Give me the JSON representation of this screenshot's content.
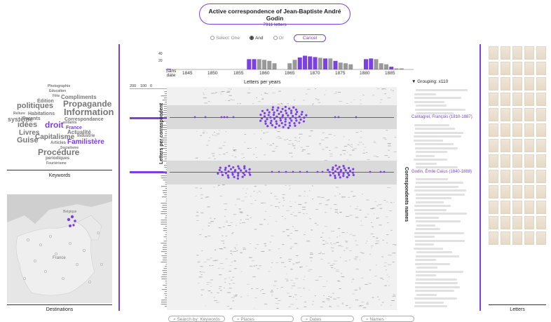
{
  "header": {
    "title": "Active correspondence of Jean-Baptiste André Godin",
    "subtitle": "7911 letters"
  },
  "select_bar": {
    "options": [
      "Select: One",
      "And",
      "Or"
    ],
    "active": "And",
    "cancel_label": "Cancel"
  },
  "keywords": {
    "label": "Keywords",
    "words": [
      {
        "text": "Photographie",
        "hl": false
      },
      {
        "text": "Education",
        "hl": false
      },
      {
        "text": "Compliments",
        "hl": false
      },
      {
        "text": "Fête",
        "hl": false
      },
      {
        "text": "Propagande",
        "hl": false
      },
      {
        "text": "Édition",
        "hl": false
      },
      {
        "text": "politiques",
        "hl": false
      },
      {
        "text": "Information",
        "hl": false
      },
      {
        "text": "Correspondance",
        "hl": false
      },
      {
        "text": "Habitations",
        "hl": false
      },
      {
        "text": "Parents",
        "hl": false
      },
      {
        "text": "Reliure",
        "hl": false
      },
      {
        "text": "système",
        "hl": false
      },
      {
        "text": "droit",
        "hl": true
      },
      {
        "text": "enfants",
        "hl": false
      },
      {
        "text": "idées",
        "hl": false
      },
      {
        "text": "France",
        "hl": true
      },
      {
        "text": "Actualité",
        "hl": false
      },
      {
        "text": "Livres",
        "hl": false
      },
      {
        "text": "Capitalisme",
        "hl": false
      },
      {
        "text": "Industrie",
        "hl": false
      },
      {
        "text": "Guise",
        "hl": false
      },
      {
        "text": "Familistère",
        "hl": true
      },
      {
        "text": "Articles",
        "hl": false
      },
      {
        "text": "Socialisme",
        "hl": false
      },
      {
        "text": "Procédure",
        "hl": false
      },
      {
        "text": "periodiques",
        "hl": false
      },
      {
        "text": "Fouriérisme",
        "hl": false
      }
    ]
  },
  "destinations": {
    "label": "Destinations",
    "map_labels": {
      "country": "France",
      "region": "Belgique"
    }
  },
  "timeline": {
    "label": "Letters per years",
    "undated_label": "Sans date",
    "years": [
      "1845",
      "1850",
      "1855",
      "1860",
      "1865",
      "1870",
      "1875",
      "1880",
      "1885"
    ],
    "y_ticks": [
      "40",
      "20"
    ],
    "x_ticks": [
      "200",
      "100",
      "0"
    ]
  },
  "chart_data": {
    "type": "bar",
    "title": "",
    "xlabel": "Letters per years",
    "ylabel": "",
    "ylim": [
      0,
      45
    ],
    "categories": [
      "Sans date",
      "1851",
      "1852",
      "1853",
      "1854",
      "1855",
      "1856",
      "1857",
      "1858",
      "1859",
      "1860",
      "1861",
      "1862",
      "1863",
      "1864",
      "1865",
      "1866",
      "1867",
      "1868",
      "1869",
      "1870",
      "1871",
      "1872",
      "1873",
      "1874",
      "1875",
      "1876",
      "1877",
      "1878",
      "1879",
      "1880",
      "1881",
      "1882"
    ],
    "series": [
      {
        "name": "",
        "values": [
          2,
          0,
          30,
          30,
          30,
          28,
          25,
          18,
          0,
          0,
          18,
          28,
          35,
          40,
          38,
          36,
          34,
          32,
          32,
          25,
          20,
          18,
          15,
          0,
          0,
          30,
          32,
          30,
          18,
          15,
          8,
          3,
          3
        ]
      }
    ],
    "highlighted": [
      true,
      false,
      true,
      true,
      false,
      false,
      false,
      false,
      false,
      false,
      false,
      false,
      true,
      true,
      true,
      true,
      false,
      true,
      false,
      true,
      false,
      false,
      false,
      false,
      false,
      true,
      true,
      false,
      false,
      false,
      true,
      false,
      false
    ]
  },
  "plot": {
    "left_axis_label": "Letters per correspondent",
    "right_axis_label": "Correspondents names",
    "grouping_label": "▼ Grouping: x110",
    "highlighted_rows": [
      {
        "name": "Cantagrel, François (1810-1887)"
      },
      {
        "name": "Godin, Émile Caïus (1840-1888)"
      }
    ]
  },
  "letters": {
    "label": "Letters",
    "thumb_count": 65
  },
  "search": {
    "by_label": "Search by: Keywords",
    "places": "Places",
    "dates": "Dates",
    "names": "Names"
  },
  "colors": {
    "accent": "#7b3fe4",
    "muted_bar": "#999999"
  }
}
